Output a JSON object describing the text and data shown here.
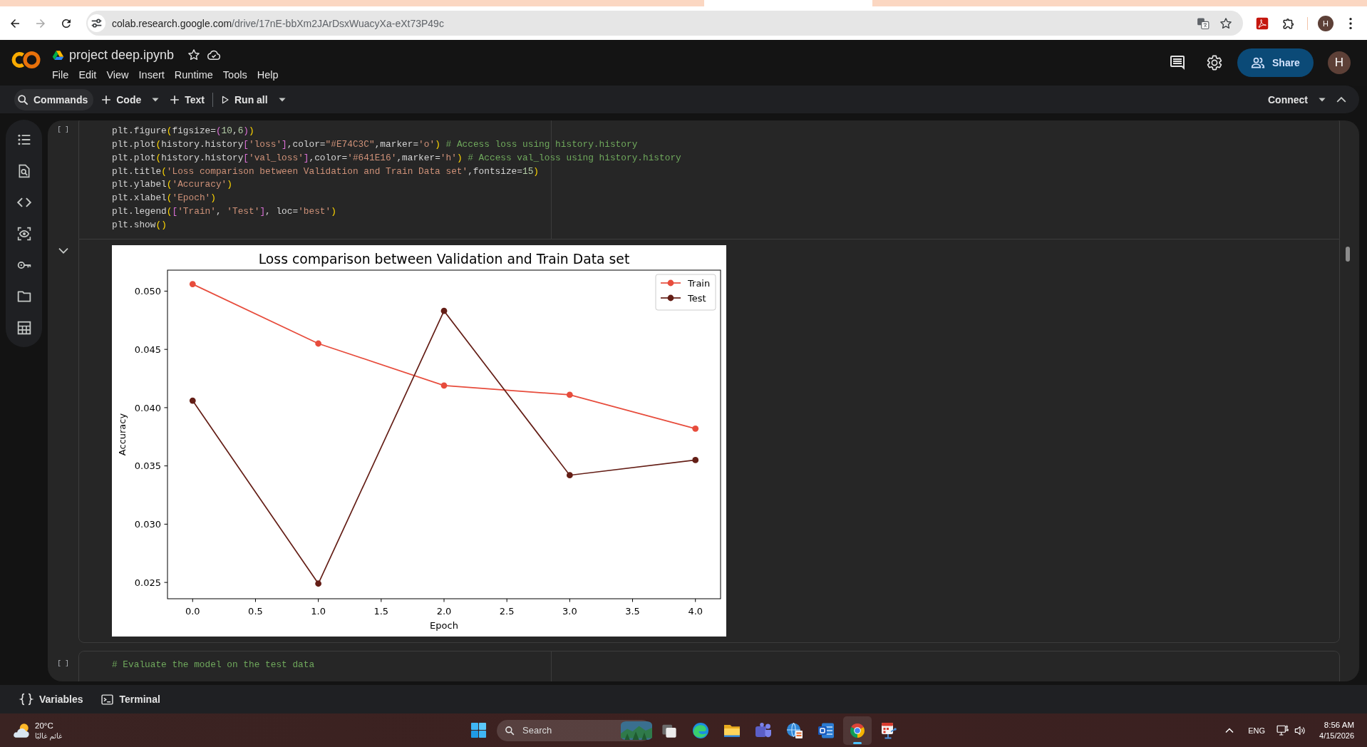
{
  "browser": {
    "nav": [
      {
        "kind": "back",
        "disabled": false
      },
      {
        "kind": "forward",
        "disabled": true
      },
      {
        "kind": "reload",
        "disabled": false
      }
    ],
    "url": {
      "host": "colab.research.google.com",
      "path": "/drive/17nE-bbXm2JArDsxWuacyXa-eXt73P49c"
    },
    "profile": "H"
  },
  "notebook": {
    "title": "project deep.ipynb",
    "menu": [
      "File",
      "Edit",
      "View",
      "Insert",
      "Runtime",
      "Tools",
      "Help"
    ],
    "share": "Share",
    "avatar": "H"
  },
  "toolbar": {
    "items": [
      {
        "kind": "commands",
        "label": "Commands",
        "dropdown": false
      },
      {
        "kind": "add",
        "label": "Code",
        "dropdown": true
      },
      {
        "kind": "add",
        "label": "Text",
        "dropdown": false
      },
      {
        "kind": "run",
        "label": "Run all",
        "dropdown": true
      }
    ],
    "connect": {
      "label": "Connect",
      "dropdown": true
    }
  },
  "cells": [
    {
      "prompt": "[ ]",
      "lines": [
        "plt.figure(figsize=(10,6))",
        "plt.plot(history.history['loss'],color=\"#E74C3C\",marker='o') # Access loss using history.history",
        "plt.plot(history.history['val_loss'],color='#641E16',marker='h') # Access val_loss using history.history",
        "plt.title('Loss comparison between Validation and Train Data set',fontsize=15)",
        "plt.ylabel('Accuracy')",
        "plt.xlabel('Epoch')",
        "plt.legend(['Train', 'Test'], loc='best')",
        "plt.show()"
      ],
      "output": {
        "expanded": true,
        "chart_data": [
          {
            "type": "line",
            "title": "Loss comparison between Validation and Train Data set",
            "xlabel": "Epoch",
            "ylabel": "Accuracy",
            "x": [
              0,
              1,
              2,
              3,
              4
            ],
            "xlim": [
              -0.2,
              4.2
            ],
            "ylim": [
              0.0236,
              0.0518
            ],
            "xticks": [
              {
                "value": 0,
                "label": "0.0"
              },
              {
                "value": 0.5,
                "label": "0.5"
              },
              {
                "value": 1,
                "label": "1.0"
              },
              {
                "value": 1.5,
                "label": "1.5"
              },
              {
                "value": 2,
                "label": "2.0"
              },
              {
                "value": 2.5,
                "label": "2.5"
              },
              {
                "value": 3,
                "label": "3.0"
              },
              {
                "value": 3.5,
                "label": "3.5"
              },
              {
                "value": 4,
                "label": "4.0"
              }
            ],
            "yticks": [
              {
                "value": 0.025,
                "label": "0.025"
              },
              {
                "value": 0.03,
                "label": "0.030"
              },
              {
                "value": 0.035,
                "label": "0.035"
              },
              {
                "value": 0.04,
                "label": "0.040"
              },
              {
                "value": 0.045,
                "label": "0.045"
              },
              {
                "value": 0.05,
                "label": "0.050"
              }
            ],
            "legend": "upper right",
            "series": [
              {
                "name": "Train",
                "color": "#e74c3c",
                "marker": "circle",
                "values": [
                  0.0506,
                  0.0455,
                  0.0419,
                  0.0411,
                  0.0382
                ]
              },
              {
                "name": "Test",
                "color": "#641e16",
                "marker": "circle",
                "values": [
                  0.0406,
                  0.0249,
                  0.0483,
                  0.0342,
                  0.0355
                ]
              }
            ]
          }
        ]
      }
    },
    {
      "prompt": "[ ]",
      "lines": [
        "# Evaluate the model on the test data"
      ]
    }
  ],
  "bottom_bar": [
    {
      "kind": "variables",
      "label": "Variables"
    },
    {
      "kind": "terminal",
      "label": "Terminal"
    }
  ],
  "taskbar": {
    "weather": {
      "temperature": "20°C",
      "condition": "غائم غالبًا"
    },
    "search": {
      "placeholder": "Search"
    },
    "apps": [
      {
        "kind": "taskview",
        "active": false
      },
      {
        "kind": "swirl",
        "active": false
      },
      {
        "kind": "folder",
        "active": false
      },
      {
        "kind": "people",
        "active": false
      },
      {
        "kind": "globe",
        "active": false
      },
      {
        "kind": "document",
        "active": false
      },
      {
        "kind": "browser",
        "active": true
      },
      {
        "kind": "tool",
        "active": false
      }
    ],
    "language": "ENG",
    "time": "8:56 AM",
    "date": "4/15/2026"
  }
}
